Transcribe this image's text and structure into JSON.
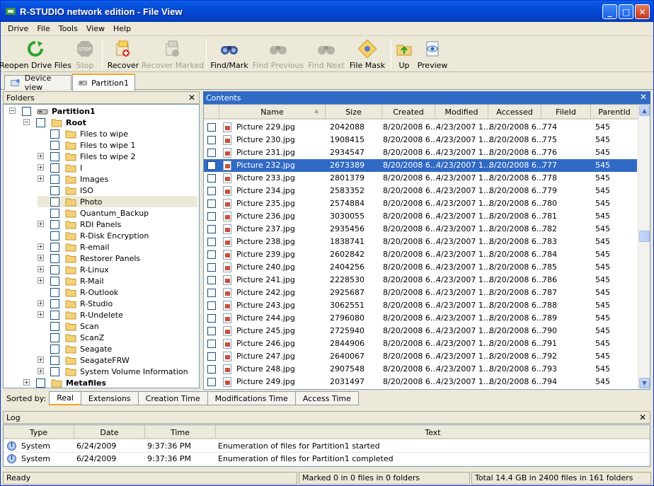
{
  "window": {
    "title": "R-STUDIO network edition - File View",
    "min": "_",
    "max": "□",
    "close": "✕"
  },
  "menu": [
    "Drive",
    "File",
    "Tools",
    "View",
    "Help"
  ],
  "toolbar": [
    {
      "label": "Reopen Drive Files",
      "icon": "reopen-icon",
      "enabled": true
    },
    {
      "label": "Stop",
      "icon": "stop-icon",
      "enabled": false
    },
    {
      "label": "Recover",
      "icon": "recover-icon",
      "enabled": true
    },
    {
      "label": "Recover Marked",
      "icon": "recover-marked-icon",
      "enabled": false
    },
    {
      "label": "Find/Mark",
      "icon": "binoculars-icon",
      "enabled": true
    },
    {
      "label": "Find Previous",
      "icon": "binoculars-prev-icon",
      "enabled": false
    },
    {
      "label": "Find Next",
      "icon": "binoculars-next-icon",
      "enabled": false
    },
    {
      "label": "File Mask",
      "icon": "file-mask-icon",
      "enabled": true
    },
    {
      "label": "Up",
      "icon": "folder-up-icon",
      "enabled": true
    },
    {
      "label": "Preview",
      "icon": "preview-icon",
      "enabled": true
    }
  ],
  "tabs": [
    {
      "label": "Device view",
      "active": false
    },
    {
      "label": "Partition1",
      "active": true
    }
  ],
  "folders": {
    "title": "Folders",
    "tree": [
      {
        "label": "Partition1",
        "level": 0,
        "expander": "minus",
        "bold": true,
        "icon": "drive-icon"
      },
      {
        "label": "Root",
        "level": 1,
        "expander": "minus",
        "bold": true
      },
      {
        "label": "Files to wipe",
        "level": 2,
        "expander": ""
      },
      {
        "label": "Files to wipe 1",
        "level": 2,
        "expander": ""
      },
      {
        "label": "Files to wipe 2",
        "level": 2,
        "expander": "plus"
      },
      {
        "label": "I",
        "level": 2,
        "expander": "plus"
      },
      {
        "label": "Images",
        "level": 2,
        "expander": "plus"
      },
      {
        "label": "ISO",
        "level": 2,
        "expander": ""
      },
      {
        "label": "Photo",
        "level": 2,
        "expander": "",
        "selected": true
      },
      {
        "label": "Quantum_Backup",
        "level": 2,
        "expander": ""
      },
      {
        "label": "RDI Panels",
        "level": 2,
        "expander": "plus"
      },
      {
        "label": "R-Disk Encryption",
        "level": 2,
        "expander": ""
      },
      {
        "label": "R-email",
        "level": 2,
        "expander": "plus"
      },
      {
        "label": "Restorer Panels",
        "level": 2,
        "expander": "plus"
      },
      {
        "label": "R-Linux",
        "level": 2,
        "expander": "plus"
      },
      {
        "label": "R-Mail",
        "level": 2,
        "expander": "plus"
      },
      {
        "label": "R-Outlook",
        "level": 2,
        "expander": ""
      },
      {
        "label": "R-Studio",
        "level": 2,
        "expander": "plus"
      },
      {
        "label": "R-Undelete",
        "level": 2,
        "expander": "plus"
      },
      {
        "label": "Scan",
        "level": 2,
        "expander": ""
      },
      {
        "label": "ScanZ",
        "level": 2,
        "expander": ""
      },
      {
        "label": "Seagate",
        "level": 2,
        "expander": ""
      },
      {
        "label": "SeagateFRW",
        "level": 2,
        "expander": "plus"
      },
      {
        "label": "System Volume Information",
        "level": 2,
        "expander": "plus"
      },
      {
        "label": "Metafiles",
        "level": 1,
        "expander": "plus",
        "bold": true
      }
    ]
  },
  "contents": {
    "title": "Contents",
    "columns": [
      "Name",
      "Size",
      "Created",
      "Modified",
      "Accessed",
      "FileId",
      "ParentId"
    ],
    "rows": [
      [
        "Picture 229.jpg",
        "2042088",
        "8/20/2008 6...",
        "4/23/2007 1...",
        "8/20/2008 6...",
        "774",
        "545"
      ],
      [
        "Picture 230.jpg",
        "1908415",
        "8/20/2008 6...",
        "4/23/2007 1...",
        "8/20/2008 6...",
        "775",
        "545"
      ],
      [
        "Picture 231.jpg",
        "2934547",
        "8/20/2008 6...",
        "4/23/2007 1...",
        "8/20/2008 6...",
        "776",
        "545"
      ],
      [
        "Picture 232.jpg",
        "2673389",
        "8/20/2008 6...",
        "4/23/2007 1...",
        "8/20/2008 6...",
        "777",
        "545"
      ],
      [
        "Picture 233.jpg",
        "2801379",
        "8/20/2008 6...",
        "4/23/2007 1...",
        "8/20/2008 6...",
        "778",
        "545"
      ],
      [
        "Picture 234.jpg",
        "2583352",
        "8/20/2008 6...",
        "4/23/2007 1...",
        "8/20/2008 6...",
        "779",
        "545"
      ],
      [
        "Picture 235.jpg",
        "2574884",
        "8/20/2008 6...",
        "4/23/2007 1...",
        "8/20/2008 6...",
        "780",
        "545"
      ],
      [
        "Picture 236.jpg",
        "3030055",
        "8/20/2008 6...",
        "4/23/2007 1...",
        "8/20/2008 6...",
        "781",
        "545"
      ],
      [
        "Picture 237.jpg",
        "2935456",
        "8/20/2008 6...",
        "4/23/2007 1...",
        "8/20/2008 6...",
        "782",
        "545"
      ],
      [
        "Picture 238.jpg",
        "1838741",
        "8/20/2008 6...",
        "4/23/2007 1...",
        "8/20/2008 6...",
        "783",
        "545"
      ],
      [
        "Picture 239.jpg",
        "2602842",
        "8/20/2008 6...",
        "4/23/2007 1...",
        "8/20/2008 6...",
        "784",
        "545"
      ],
      [
        "Picture 240.jpg",
        "2404256",
        "8/20/2008 6...",
        "4/23/2007 1...",
        "8/20/2008 6...",
        "785",
        "545"
      ],
      [
        "Picture 241.jpg",
        "2228530",
        "8/20/2008 6...",
        "4/23/2007 1...",
        "8/20/2008 6...",
        "786",
        "545"
      ],
      [
        "Picture 242.jpg",
        "2925687",
        "8/20/2008 6...",
        "4/23/2007 1...",
        "8/20/2008 6...",
        "787",
        "545"
      ],
      [
        "Picture 243.jpg",
        "3062551",
        "8/20/2008 6...",
        "4/23/2007 1...",
        "8/20/2008 6...",
        "788",
        "545"
      ],
      [
        "Picture 244.jpg",
        "2796080",
        "8/20/2008 6...",
        "4/23/2007 1...",
        "8/20/2008 6...",
        "789",
        "545"
      ],
      [
        "Picture 245.jpg",
        "2725940",
        "8/20/2008 6...",
        "4/23/2007 1...",
        "8/20/2008 6...",
        "790",
        "545"
      ],
      [
        "Picture 246.jpg",
        "2844906",
        "8/20/2008 6...",
        "4/23/2007 1...",
        "8/20/2008 6...",
        "791",
        "545"
      ],
      [
        "Picture 247.jpg",
        "2640067",
        "8/20/2008 6...",
        "4/23/2007 1...",
        "8/20/2008 6...",
        "792",
        "545"
      ],
      [
        "Picture 248.jpg",
        "2907548",
        "8/20/2008 6...",
        "4/23/2007 1...",
        "8/20/2008 6...",
        "793",
        "545"
      ],
      [
        "Picture 249.jpg",
        "2031497",
        "8/20/2008 6...",
        "4/23/2007 1...",
        "8/20/2008 6...",
        "794",
        "545"
      ]
    ],
    "selected_row": 3
  },
  "sort": {
    "label": "Sorted by:",
    "tabs": [
      "Real",
      "Extensions",
      "Creation Time",
      "Modifications Time",
      "Access Time"
    ],
    "active": 0
  },
  "log": {
    "title": "Log",
    "columns": [
      "Type",
      "Date",
      "Time",
      "Text"
    ],
    "rows": [
      [
        "System",
        "6/24/2009",
        "9:37:36 PM",
        "Enumeration of files for Partition1 started"
      ],
      [
        "System",
        "6/24/2009",
        "9:37:36 PM",
        "Enumeration of files for Partition1 completed"
      ]
    ]
  },
  "status": {
    "ready": "Ready",
    "marked": "Marked 0 in 0 files in 0 folders",
    "total": "Total 14.4 GB in 2400 files in 161 folders"
  },
  "close_glyph": "✕",
  "colors": {
    "selection": "#316ac5",
    "titlebar": "#0449d6",
    "folder": "#f3d27a"
  }
}
